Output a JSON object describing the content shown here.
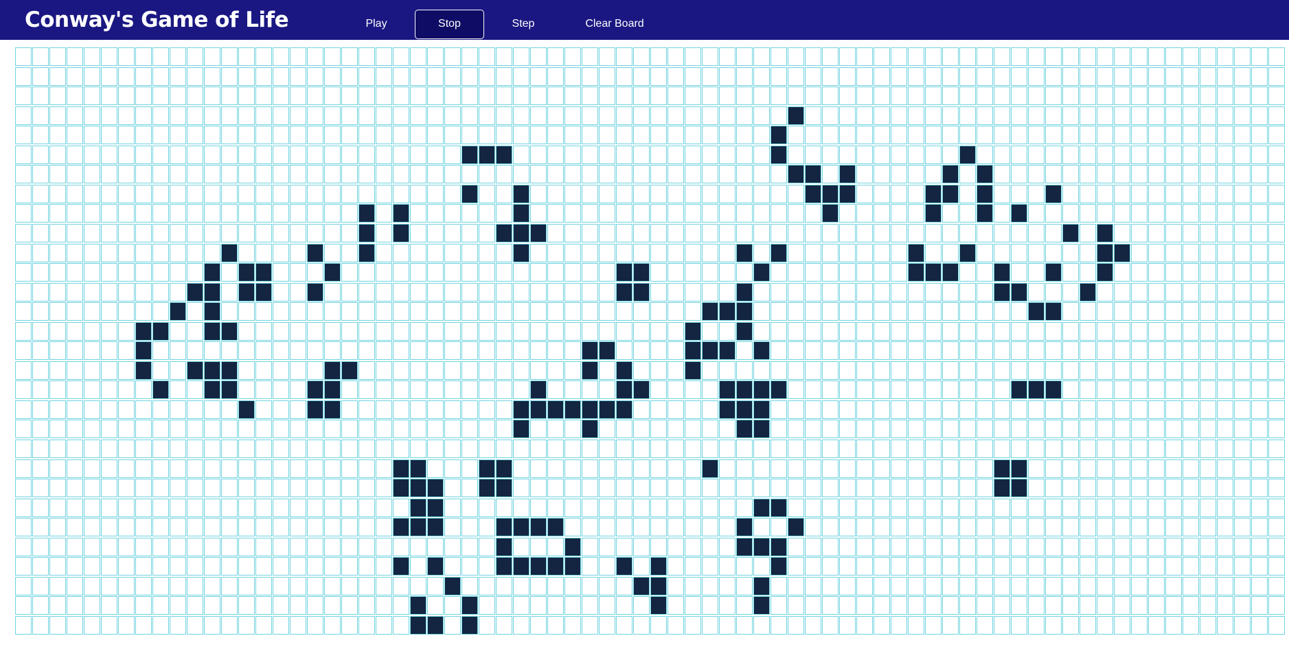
{
  "header": {
    "title": "Conway's Game of Life",
    "buttons": {
      "play": "Play",
      "stop": "Stop",
      "step": "Step",
      "clear": "Clear Board"
    },
    "colors": {
      "background": "#1a1782",
      "text": "#ffffff"
    }
  },
  "board": {
    "rows": 30,
    "cols": 74,
    "colors": {
      "alive": "#132541",
      "dead": "#ffffff",
      "grid_line": "#6fd3df"
    },
    "alive_cells": [
      [
        3,
        45
      ],
      [
        4,
        44
      ],
      [
        5,
        26
      ],
      [
        5,
        27
      ],
      [
        5,
        28
      ],
      [
        5,
        44
      ],
      [
        5,
        55
      ],
      [
        6,
        45
      ],
      [
        6,
        46
      ],
      [
        6,
        48
      ],
      [
        6,
        54
      ],
      [
        6,
        56
      ],
      [
        7,
        26
      ],
      [
        7,
        29
      ],
      [
        7,
        46
      ],
      [
        7,
        47
      ],
      [
        7,
        48
      ],
      [
        7,
        53
      ],
      [
        7,
        54
      ],
      [
        7,
        56
      ],
      [
        7,
        60
      ],
      [
        8,
        20
      ],
      [
        8,
        22
      ],
      [
        8,
        29
      ],
      [
        8,
        47
      ],
      [
        8,
        53
      ],
      [
        8,
        56
      ],
      [
        8,
        58
      ],
      [
        9,
        20
      ],
      [
        9,
        22
      ],
      [
        9,
        28
      ],
      [
        9,
        29
      ],
      [
        9,
        30
      ],
      [
        9,
        61
      ],
      [
        9,
        63
      ],
      [
        10,
        12
      ],
      [
        10,
        17
      ],
      [
        10,
        20
      ],
      [
        10,
        29
      ],
      [
        10,
        42
      ],
      [
        10,
        44
      ],
      [
        10,
        52
      ],
      [
        10,
        55
      ],
      [
        10,
        63
      ],
      [
        10,
        64
      ],
      [
        11,
        11
      ],
      [
        11,
        13
      ],
      [
        11,
        14
      ],
      [
        11,
        18
      ],
      [
        11,
        35
      ],
      [
        11,
        36
      ],
      [
        11,
        43
      ],
      [
        11,
        52
      ],
      [
        11,
        53
      ],
      [
        11,
        54
      ],
      [
        11,
        57
      ],
      [
        11,
        60
      ],
      [
        11,
        63
      ],
      [
        12,
        10
      ],
      [
        12,
        11
      ],
      [
        12,
        13
      ],
      [
        12,
        14
      ],
      [
        12,
        17
      ],
      [
        12,
        35
      ],
      [
        12,
        36
      ],
      [
        12,
        42
      ],
      [
        12,
        57
      ],
      [
        12,
        58
      ],
      [
        12,
        62
      ],
      [
        13,
        9
      ],
      [
        13,
        11
      ],
      [
        13,
        40
      ],
      [
        13,
        41
      ],
      [
        13,
        42
      ],
      [
        13,
        59
      ],
      [
        13,
        60
      ],
      [
        14,
        7
      ],
      [
        14,
        8
      ],
      [
        14,
        11
      ],
      [
        14,
        12
      ],
      [
        14,
        39
      ],
      [
        14,
        42
      ],
      [
        15,
        7
      ],
      [
        15,
        33
      ],
      [
        15,
        34
      ],
      [
        15,
        39
      ],
      [
        15,
        40
      ],
      [
        15,
        41
      ],
      [
        15,
        43
      ],
      [
        16,
        7
      ],
      [
        16,
        10
      ],
      [
        16,
        11
      ],
      [
        16,
        12
      ],
      [
        16,
        18
      ],
      [
        16,
        19
      ],
      [
        16,
        33
      ],
      [
        16,
        35
      ],
      [
        16,
        39
      ],
      [
        17,
        8
      ],
      [
        17,
        11
      ],
      [
        17,
        12
      ],
      [
        17,
        17
      ],
      [
        17,
        18
      ],
      [
        17,
        30
      ],
      [
        17,
        35
      ],
      [
        17,
        36
      ],
      [
        17,
        41
      ],
      [
        17,
        42
      ],
      [
        17,
        43
      ],
      [
        17,
        44
      ],
      [
        17,
        58
      ],
      [
        17,
        59
      ],
      [
        17,
        60
      ],
      [
        18,
        13
      ],
      [
        18,
        17
      ],
      [
        18,
        18
      ],
      [
        18,
        29
      ],
      [
        18,
        30
      ],
      [
        18,
        31
      ],
      [
        18,
        32
      ],
      [
        18,
        33
      ],
      [
        18,
        34
      ],
      [
        18,
        35
      ],
      [
        18,
        41
      ],
      [
        18,
        42
      ],
      [
        18,
        43
      ],
      [
        19,
        29
      ],
      [
        19,
        33
      ],
      [
        19,
        42
      ],
      [
        19,
        43
      ],
      [
        21,
        22
      ],
      [
        21,
        23
      ],
      [
        21,
        27
      ],
      [
        21,
        28
      ],
      [
        21,
        40
      ],
      [
        21,
        57
      ],
      [
        21,
        58
      ],
      [
        22,
        22
      ],
      [
        22,
        23
      ],
      [
        22,
        24
      ],
      [
        22,
        27
      ],
      [
        22,
        28
      ],
      [
        22,
        57
      ],
      [
        22,
        58
      ],
      [
        23,
        23
      ],
      [
        23,
        24
      ],
      [
        23,
        43
      ],
      [
        23,
        44
      ],
      [
        24,
        22
      ],
      [
        24,
        23
      ],
      [
        24,
        24
      ],
      [
        24,
        28
      ],
      [
        24,
        29
      ],
      [
        24,
        30
      ],
      [
        24,
        31
      ],
      [
        24,
        42
      ],
      [
        24,
        45
      ],
      [
        25,
        28
      ],
      [
        25,
        32
      ],
      [
        25,
        42
      ],
      [
        25,
        43
      ],
      [
        25,
        44
      ],
      [
        26,
        22
      ],
      [
        26,
        24
      ],
      [
        26,
        28
      ],
      [
        26,
        29
      ],
      [
        26,
        30
      ],
      [
        26,
        31
      ],
      [
        26,
        32
      ],
      [
        26,
        35
      ],
      [
        26,
        37
      ],
      [
        26,
        44
      ],
      [
        27,
        25
      ],
      [
        27,
        36
      ],
      [
        27,
        37
      ],
      [
        27,
        43
      ],
      [
        28,
        23
      ],
      [
        28,
        26
      ],
      [
        28,
        37
      ],
      [
        28,
        43
      ],
      [
        29,
        23
      ],
      [
        29,
        24
      ],
      [
        29,
        26
      ]
    ]
  }
}
